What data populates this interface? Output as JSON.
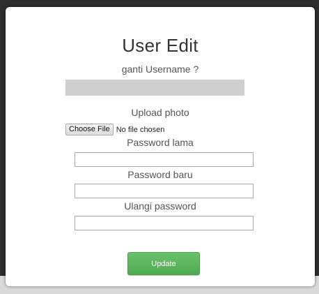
{
  "modal": {
    "title": "User Edit"
  },
  "form": {
    "username_label": "ganti Username ?",
    "username_value": "",
    "photo_label": "Upload photo",
    "file_button_label": "Choose File",
    "file_status": "No file chosen",
    "old_password_label": "Password lama",
    "new_password_label": "Password baru",
    "repeat_password_label": "Ulangi password",
    "submit_label": "Update"
  },
  "colors": {
    "submit_button": "#5cb85c",
    "username_field_bg": "#cfcfcf",
    "backdrop": "#2d2d2d"
  }
}
